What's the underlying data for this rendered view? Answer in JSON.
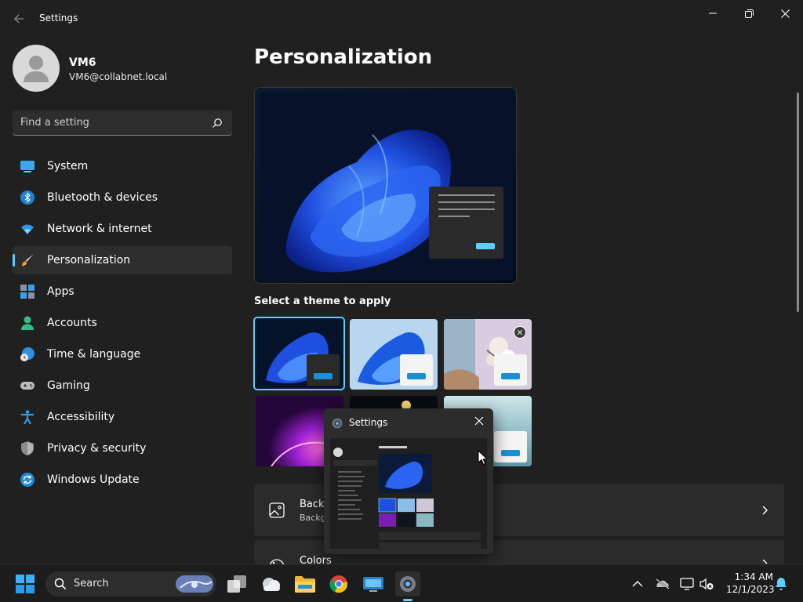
{
  "window": {
    "title": "Settings"
  },
  "profile": {
    "name": "VM6",
    "email": "VM6@collabnet.local"
  },
  "search": {
    "placeholder": "Find a setting"
  },
  "nav": {
    "items": [
      {
        "label": "System",
        "icon": "system-monitor-icon"
      },
      {
        "label": "Bluetooth & devices",
        "icon": "bluetooth-icon"
      },
      {
        "label": "Network & internet",
        "icon": "wifi-icon"
      },
      {
        "label": "Personalization",
        "icon": "paintbrush-icon",
        "active": true
      },
      {
        "label": "Apps",
        "icon": "apps-icon"
      },
      {
        "label": "Accounts",
        "icon": "account-icon"
      },
      {
        "label": "Time & language",
        "icon": "clock-globe-icon"
      },
      {
        "label": "Gaming",
        "icon": "gamepad-icon"
      },
      {
        "label": "Accessibility",
        "icon": "accessibility-icon"
      },
      {
        "label": "Privacy & security",
        "icon": "shield-icon"
      },
      {
        "label": "Windows Update",
        "icon": "update-icon"
      }
    ]
  },
  "main": {
    "title": "Personalization",
    "themes_label": "Select a theme to apply",
    "cards": [
      {
        "title": "Backg",
        "subtitle": "Backg",
        "icon": "image-icon"
      },
      {
        "title": "Colors",
        "icon": "palette-icon"
      }
    ]
  },
  "popup": {
    "title": "Settings"
  },
  "taskbar": {
    "search_label": "Search",
    "time": "1:34 AM",
    "date": "12/1/2023"
  },
  "colors": {
    "accent": "#60cdff",
    "background": "#202020",
    "card": "#2b2b2b"
  }
}
